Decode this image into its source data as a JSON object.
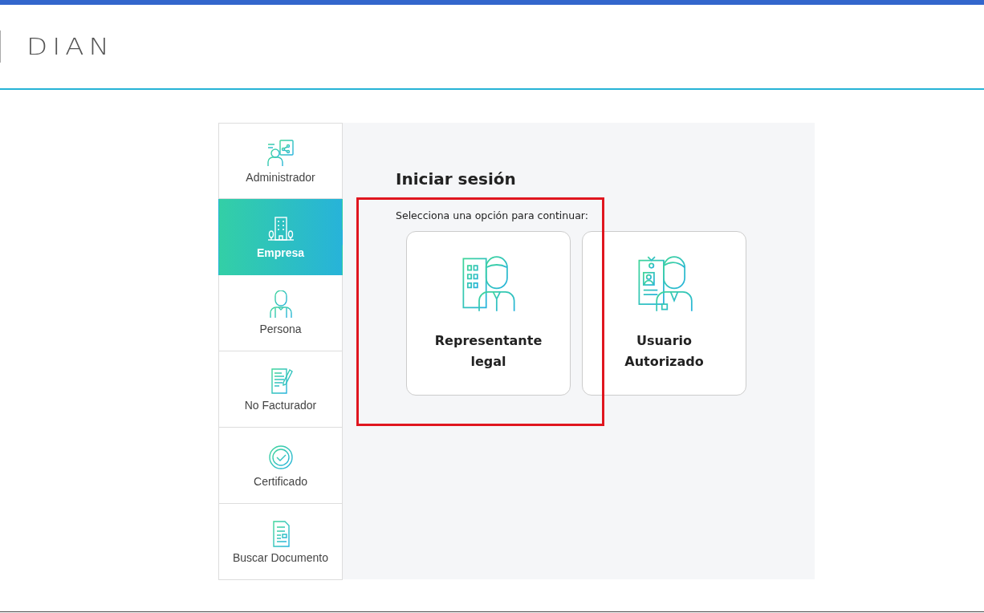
{
  "header": {
    "logo": "DIAN"
  },
  "sidebar": {
    "items": [
      {
        "kind": "admin",
        "label": "Administrador",
        "selected": false
      },
      {
        "kind": "company",
        "label": "Empresa",
        "selected": true
      },
      {
        "kind": "person",
        "label": "Persona",
        "selected": false
      },
      {
        "kind": "invoice",
        "label": "No Facturador",
        "selected": false
      },
      {
        "kind": "certificate",
        "label": "Certificado",
        "selected": false
      },
      {
        "kind": "document",
        "label": "Buscar Documento",
        "selected": false
      }
    ]
  },
  "login": {
    "title": "Iniciar sesión",
    "subtitle": "Selecciona una opción para continuar:",
    "options": [
      {
        "kind": "legal",
        "label": "Representante legal"
      },
      {
        "kind": "authorized",
        "label": "Usuario Autorizado"
      }
    ]
  }
}
